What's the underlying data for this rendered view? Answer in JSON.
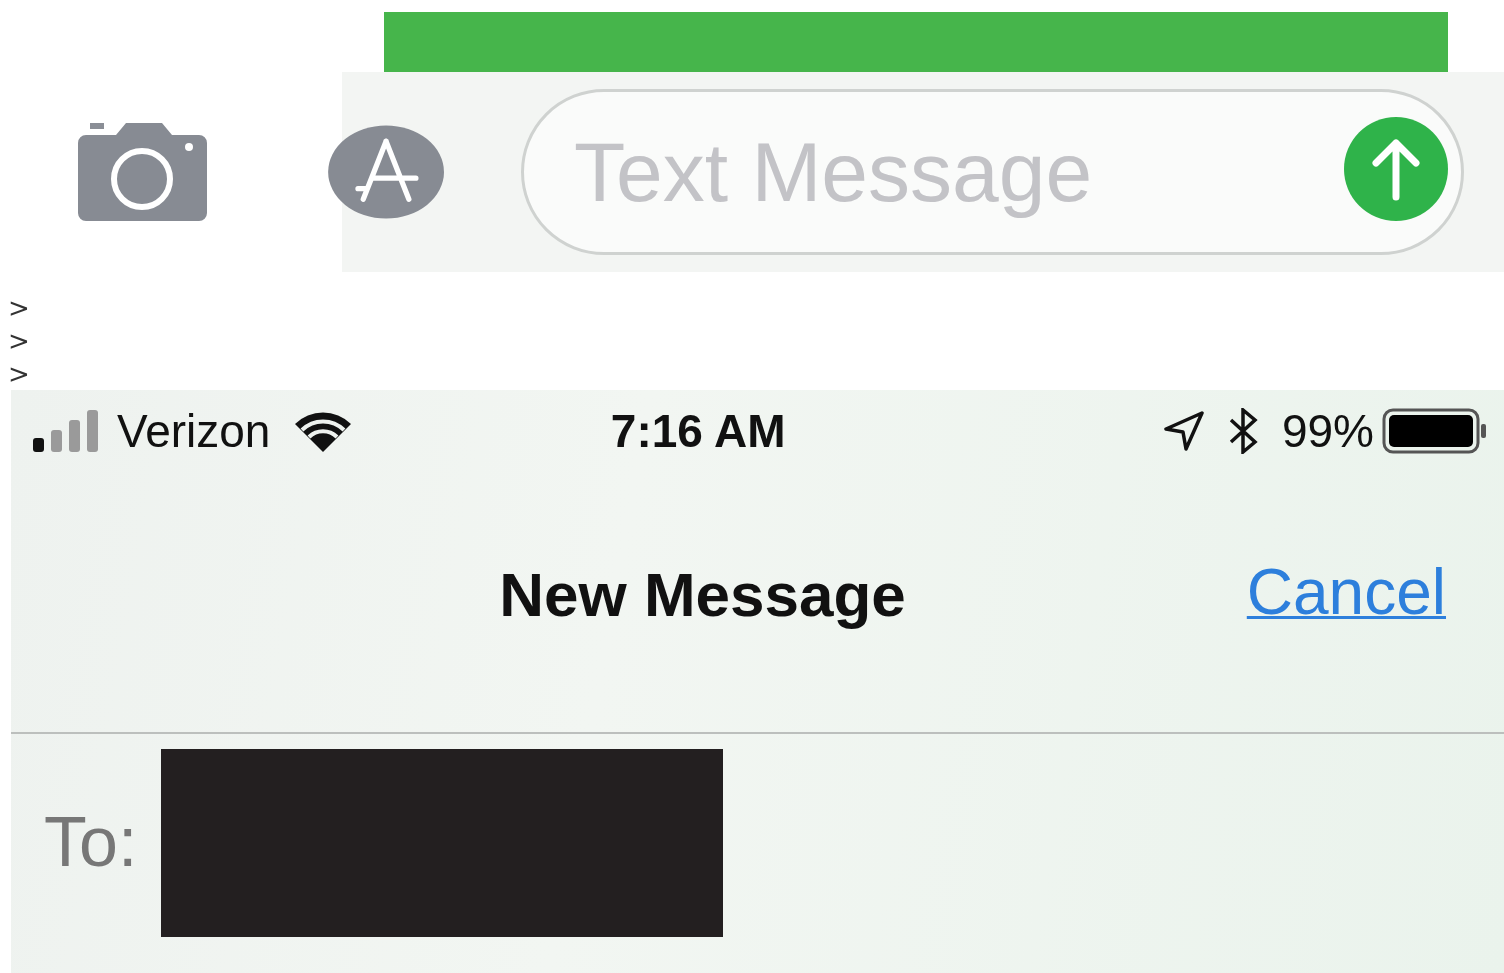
{
  "composer": {
    "placeholder": "Text Message"
  },
  "quote_marks": [
    ">",
    ">",
    ">"
  ],
  "status_bar": {
    "carrier": "Verizon",
    "time": "7:16 AM",
    "battery": "99%"
  },
  "nav_bar": {
    "title": "New Message",
    "cancel": "Cancel"
  },
  "recipient": {
    "label": "To:"
  }
}
